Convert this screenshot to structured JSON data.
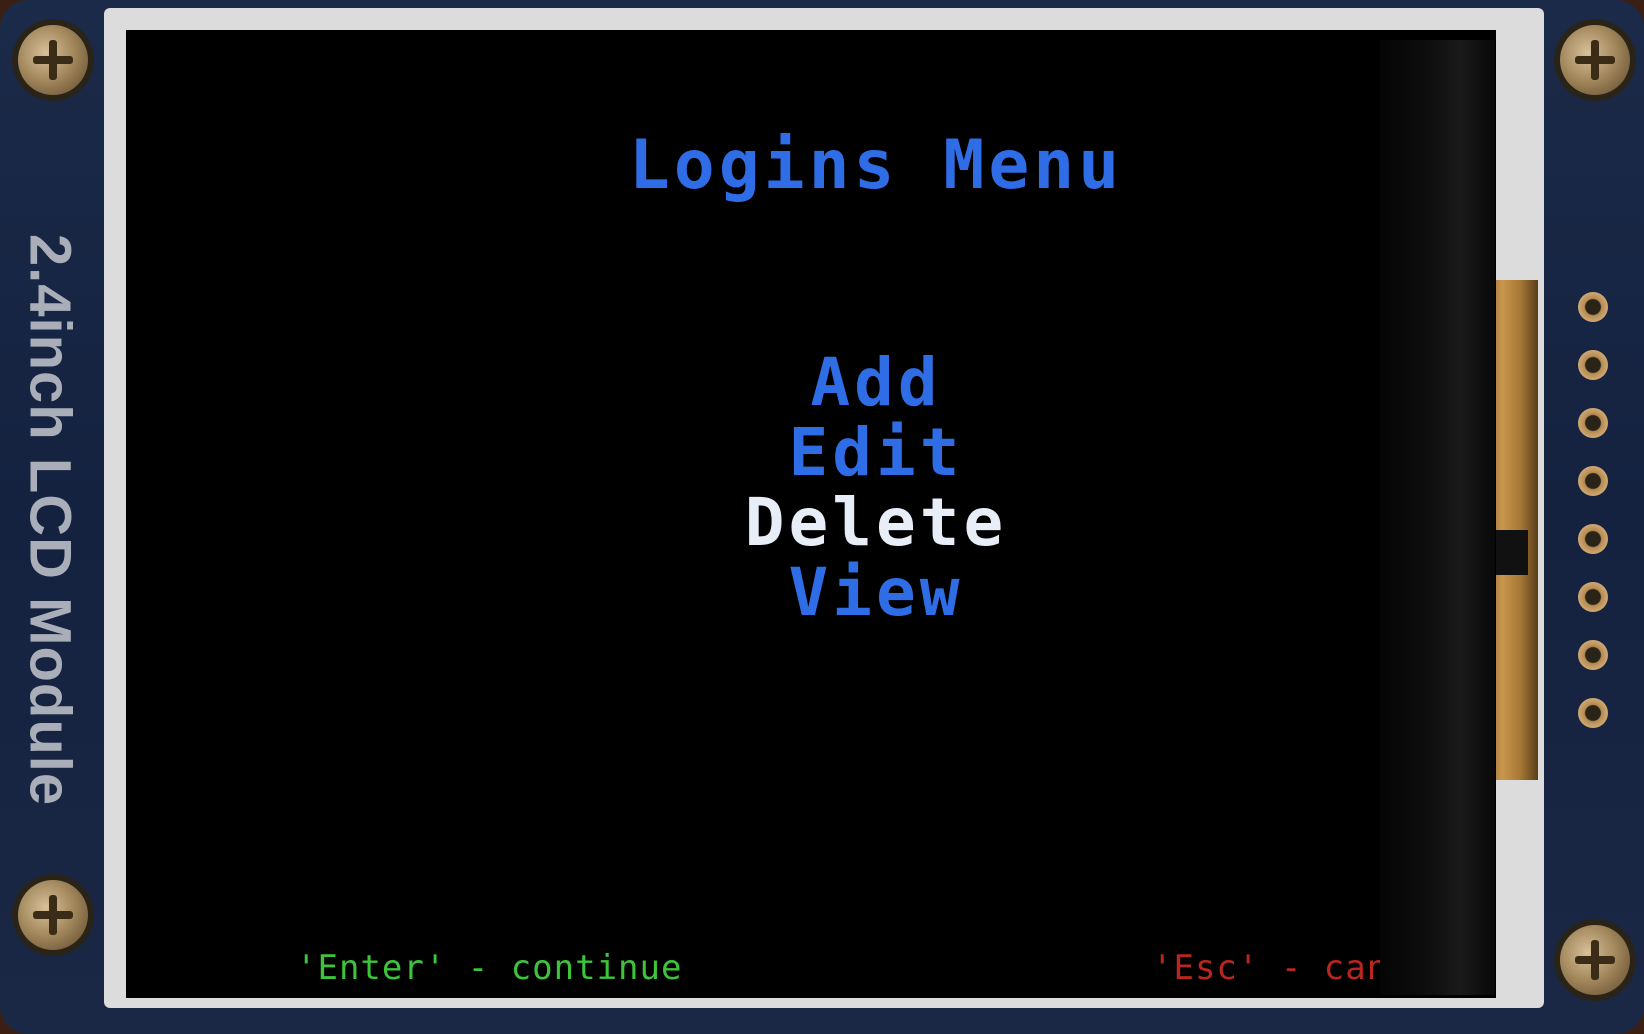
{
  "device": {
    "label": "2.4inch LCD Module"
  },
  "screen": {
    "title": "Logins Menu",
    "menu_items": [
      {
        "label": "Add",
        "selected": false
      },
      {
        "label": "Edit",
        "selected": false
      },
      {
        "label": "Delete",
        "selected": true
      },
      {
        "label": "View",
        "selected": false
      }
    ],
    "hint_enter": "'Enter' - continue",
    "hint_esc": "'Esc' - cancel"
  },
  "colors": {
    "menu_text": "#2f6de6",
    "selected_text": "#e8eef8",
    "enter_hint": "#3cc43a",
    "esc_hint": "#b8261e",
    "screen_bg": "#000000"
  }
}
